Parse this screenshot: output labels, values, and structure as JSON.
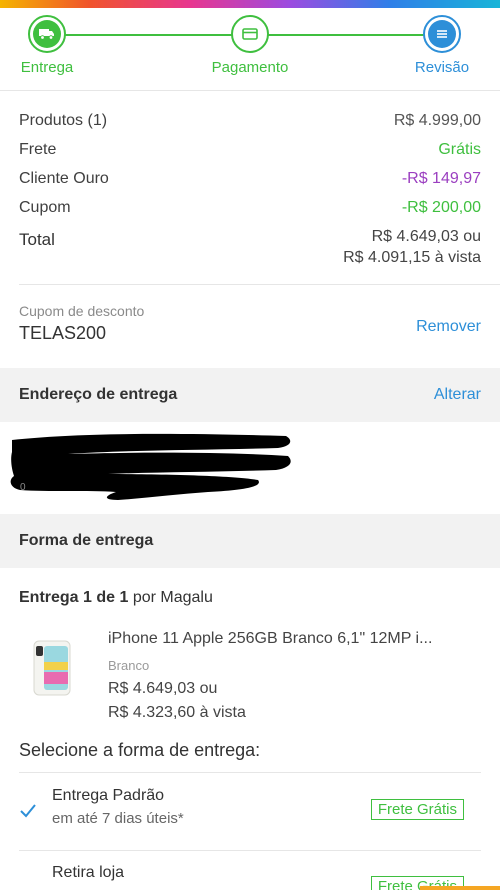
{
  "stepper": {
    "steps": [
      {
        "label": "Entrega",
        "icon": "truck-icon"
      },
      {
        "label": "Pagamento",
        "icon": "card-icon"
      },
      {
        "label": "Revisão",
        "icon": "list-icon"
      }
    ]
  },
  "summary": {
    "rows": [
      {
        "label": "Produtos (1)",
        "value": "R$ 4.999,00"
      },
      {
        "label": "Frete",
        "value": "Grátis"
      },
      {
        "label": "Cliente Ouro",
        "value": "-R$ 149,97"
      },
      {
        "label": "Cupom",
        "value": "-R$ 200,00"
      }
    ],
    "total_label": "Total",
    "total_value": "R$ 4.649,03 ou",
    "total_cash": "R$ 4.091,15 à vista"
  },
  "coupon": {
    "label": "Cupom de desconto",
    "code": "TELAS200",
    "remove": "Remover"
  },
  "address": {
    "title": "Endereço de entrega",
    "action": "Alterar"
  },
  "shipping_form": {
    "title": "Forma de entrega"
  },
  "delivery": {
    "label": "Entrega 1 de 1",
    "seller_prefix": "por",
    "seller": "Magalu"
  },
  "product": {
    "name": "iPhone 11 Apple 256GB Branco 6,1\" 12MP i...",
    "color": "Branco",
    "price": "R$ 4.649,03 ou",
    "cash_price": "R$ 4.323,60 à vista"
  },
  "select": {
    "title": "Selecione a forma de entrega:",
    "options": [
      {
        "name": "Entrega Padrão",
        "sub": "em até 7 dias úteis*",
        "badge": "Frete Grátis",
        "selected": true
      },
      {
        "name": "Retira loja",
        "badge": "Frete Grátis"
      }
    ]
  },
  "colors": {
    "green": "#3fbf3f",
    "blue": "#2d8fd8",
    "purple": "#9b3fc0"
  }
}
